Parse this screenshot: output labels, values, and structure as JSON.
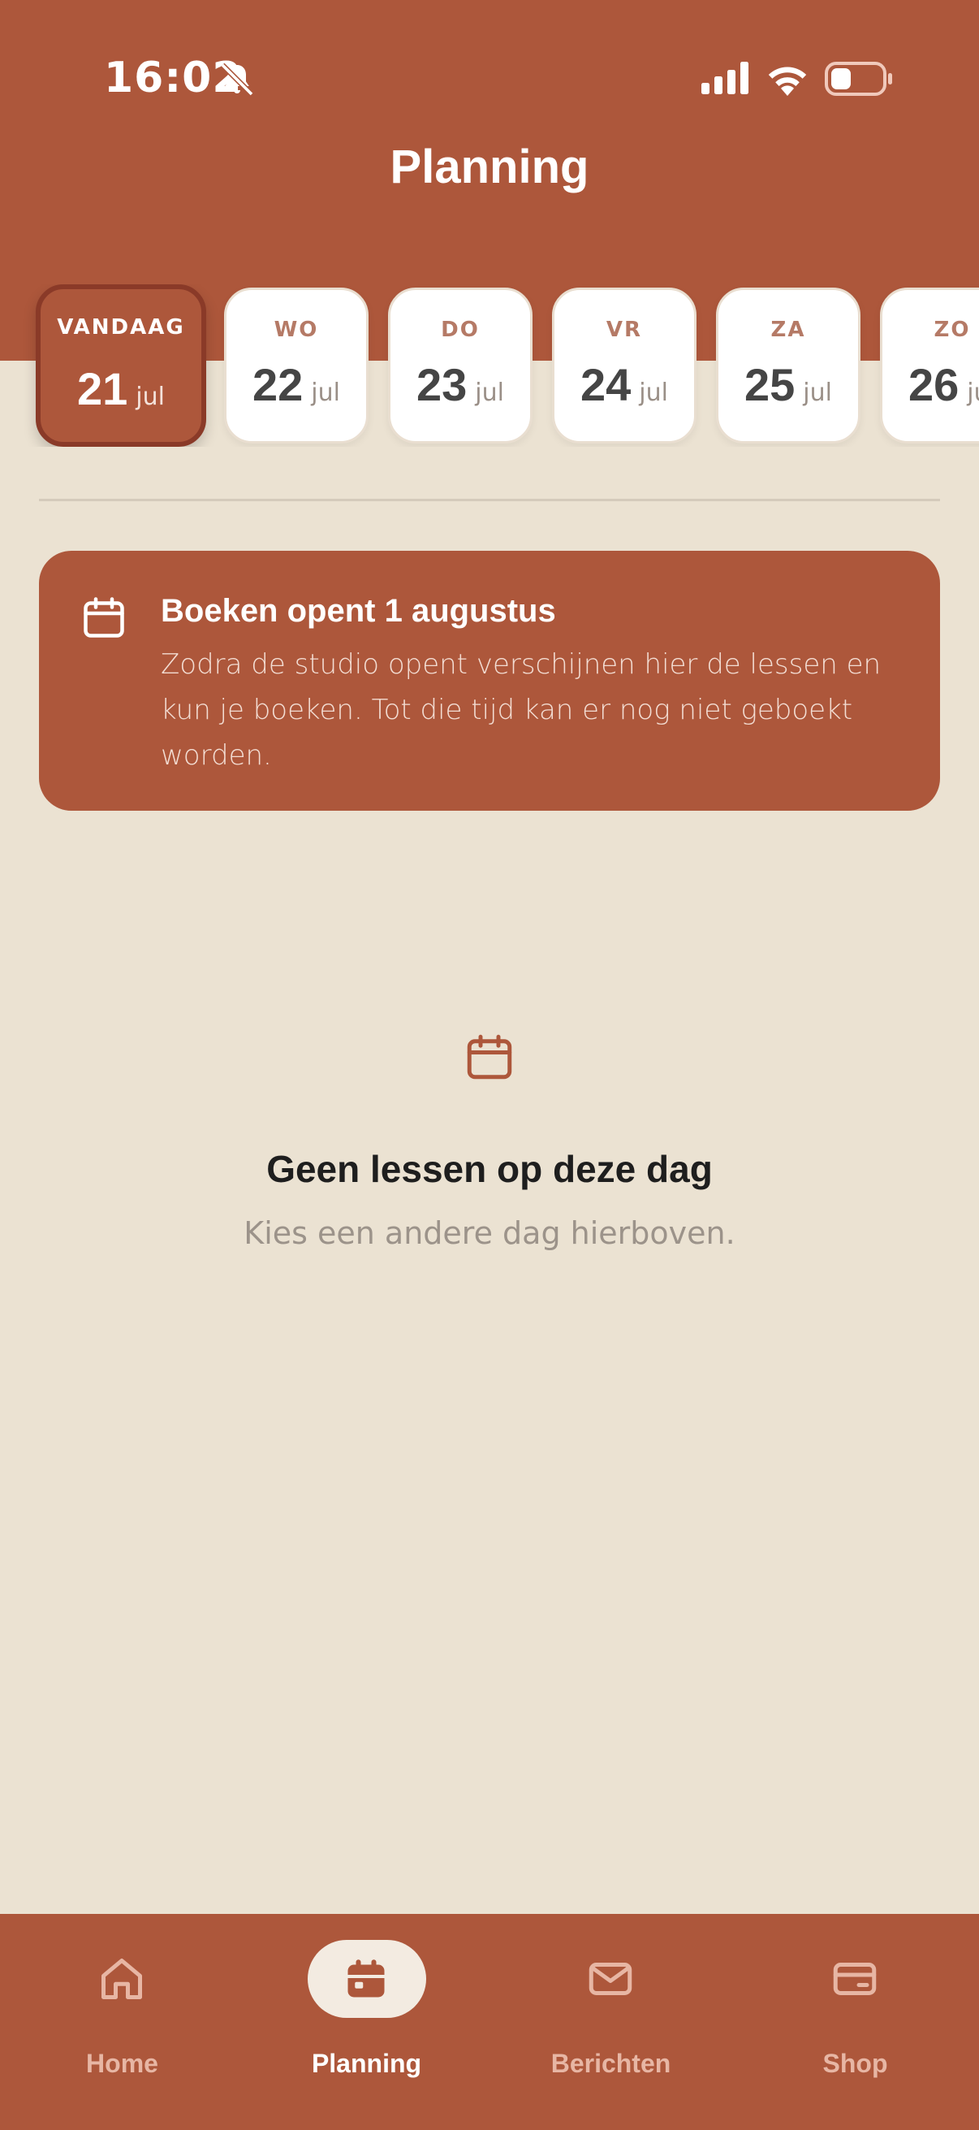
{
  "colors": {
    "brand": "#ad573b",
    "background": "#ebe2d2",
    "active_border": "#8a3a28"
  },
  "status_bar": {
    "time": "16:02",
    "icons": [
      "bell-slash-icon",
      "signal-icon",
      "wifi-icon",
      "battery-icon"
    ]
  },
  "header": {
    "title": "Planning"
  },
  "days": [
    {
      "label": "VANDAAG",
      "day": "21",
      "month": "jul",
      "active": true
    },
    {
      "label": "WO",
      "day": "22",
      "month": "jul",
      "active": false
    },
    {
      "label": "DO",
      "day": "23",
      "month": "jul",
      "active": false
    },
    {
      "label": "VR",
      "day": "24",
      "month": "jul",
      "active": false
    },
    {
      "label": "ZA",
      "day": "25",
      "month": "jul",
      "active": false
    },
    {
      "label": "ZO",
      "day": "26",
      "month": "jul",
      "active": false
    }
  ],
  "notice": {
    "icon": "calendar-icon",
    "title": "Boeken opent 1 augustus",
    "text": "Zodra de studio opent verschijnen hier de lessen en kun je boeken. Tot die tijd kan er nog niet geboekt worden."
  },
  "empty_state": {
    "icon": "calendar-icon",
    "title": "Geen lessen op deze dag",
    "subtitle": "Kies een andere dag hierboven."
  },
  "bottom_nav": [
    {
      "label": "Home",
      "icon": "home-icon",
      "active": false
    },
    {
      "label": "Planning",
      "icon": "calendar-icon",
      "active": true
    },
    {
      "label": "Berichten",
      "icon": "mail-icon",
      "active": false
    },
    {
      "label": "Shop",
      "icon": "card-icon",
      "active": false
    }
  ]
}
